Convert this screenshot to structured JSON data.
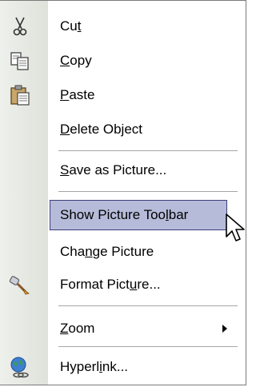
{
  "menu": {
    "items": [
      {
        "prefix": "Cu",
        "mnemonic": "t",
        "suffix": "",
        "icon": "scissors-icon"
      },
      {
        "prefix": "",
        "mnemonic": "C",
        "suffix": "opy",
        "icon": "copy-icon"
      },
      {
        "prefix": "",
        "mnemonic": "P",
        "suffix": "aste",
        "icon": "paste-icon"
      },
      {
        "prefix": "",
        "mnemonic": "D",
        "suffix": "elete Object"
      },
      {
        "prefix": "",
        "mnemonic": "S",
        "suffix": "ave as Picture..."
      },
      {
        "prefix": "Show Picture Too",
        "mnemonic": "l",
        "suffix": "bar"
      },
      {
        "prefix": "Cha",
        "mnemonic": "n",
        "suffix": "ge Picture"
      },
      {
        "prefix": "Format Pict",
        "mnemonic": "u",
        "suffix": "re...",
        "icon": "format-brush-icon"
      },
      {
        "prefix": "",
        "mnemonic": "Z",
        "suffix": "oom",
        "submenu": "submenu-arrow-icon"
      },
      {
        "prefix": "Hyperl",
        "mnemonic": "i",
        "suffix": "nk...",
        "icon": "hyperlink-globe-icon"
      }
    ]
  },
  "colors": {
    "highlight_bg": "#b6bbd9",
    "highlight_border": "#3a3f7a",
    "gutter": "#e3e5de"
  }
}
